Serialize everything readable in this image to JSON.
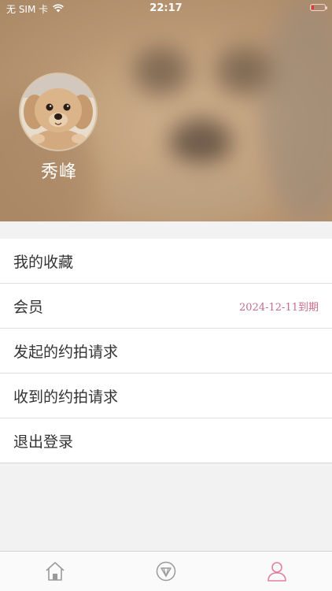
{
  "status_bar": {
    "carrier": "无 SIM 卡",
    "time": "22:17"
  },
  "profile": {
    "username": "秀峰"
  },
  "menu": [
    {
      "label": "我的收藏",
      "detail": ""
    },
    {
      "label": "会员",
      "detail": "2024-12-11到期"
    },
    {
      "label": "发起的约拍请求",
      "detail": ""
    },
    {
      "label": "收到的约拍请求",
      "detail": ""
    },
    {
      "label": "退出登录",
      "detail": ""
    }
  ],
  "tabbar": {
    "tabs": [
      {
        "icon": "home-icon",
        "active": false
      },
      {
        "icon": "diamond-icon",
        "active": false
      },
      {
        "icon": "profile-icon",
        "active": true
      }
    ],
    "active_color": "#e17fa0",
    "inactive_color": "#9a9a9a"
  },
  "colors": {
    "expire_text": "#c66d8a",
    "battery_low": "#e33333"
  }
}
